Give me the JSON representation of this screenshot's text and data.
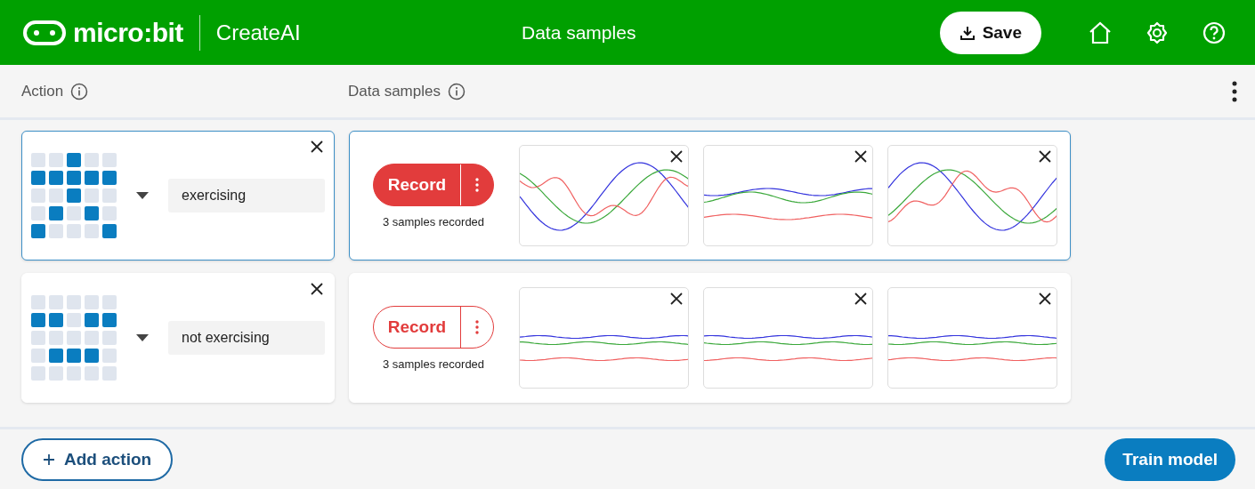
{
  "header": {
    "brand": "micro:bit",
    "product": "CreateAI",
    "title": "Data samples",
    "save_label": "Save"
  },
  "columns": {
    "action": "Action",
    "data": "Data samples"
  },
  "actions": [
    {
      "name": "exercising",
      "selected": true,
      "record_label": "Record",
      "count": "3 samples recorded",
      "leds": [
        [
          false,
          false,
          true,
          false,
          false
        ],
        [
          true,
          true,
          true,
          true,
          true
        ],
        [
          false,
          false,
          true,
          false,
          false
        ],
        [
          false,
          true,
          false,
          true,
          false
        ],
        [
          true,
          false,
          false,
          false,
          true
        ]
      ],
      "samples": [
        {
          "kind": "active"
        },
        {
          "kind": "mild"
        },
        {
          "kind": "active"
        }
      ]
    },
    {
      "name": "not exercising",
      "selected": false,
      "record_label": "Record",
      "count": "3 samples recorded",
      "leds": [
        [
          false,
          false,
          false,
          false,
          false
        ],
        [
          true,
          true,
          false,
          true,
          true
        ],
        [
          false,
          false,
          false,
          false,
          false
        ],
        [
          false,
          true,
          true,
          true,
          false
        ],
        [
          false,
          false,
          false,
          false,
          false
        ]
      ],
      "samples": [
        {
          "kind": "still"
        },
        {
          "kind": "still"
        },
        {
          "kind": "still"
        }
      ]
    }
  ],
  "footer": {
    "add_label": "Add action",
    "train_label": "Train model"
  }
}
